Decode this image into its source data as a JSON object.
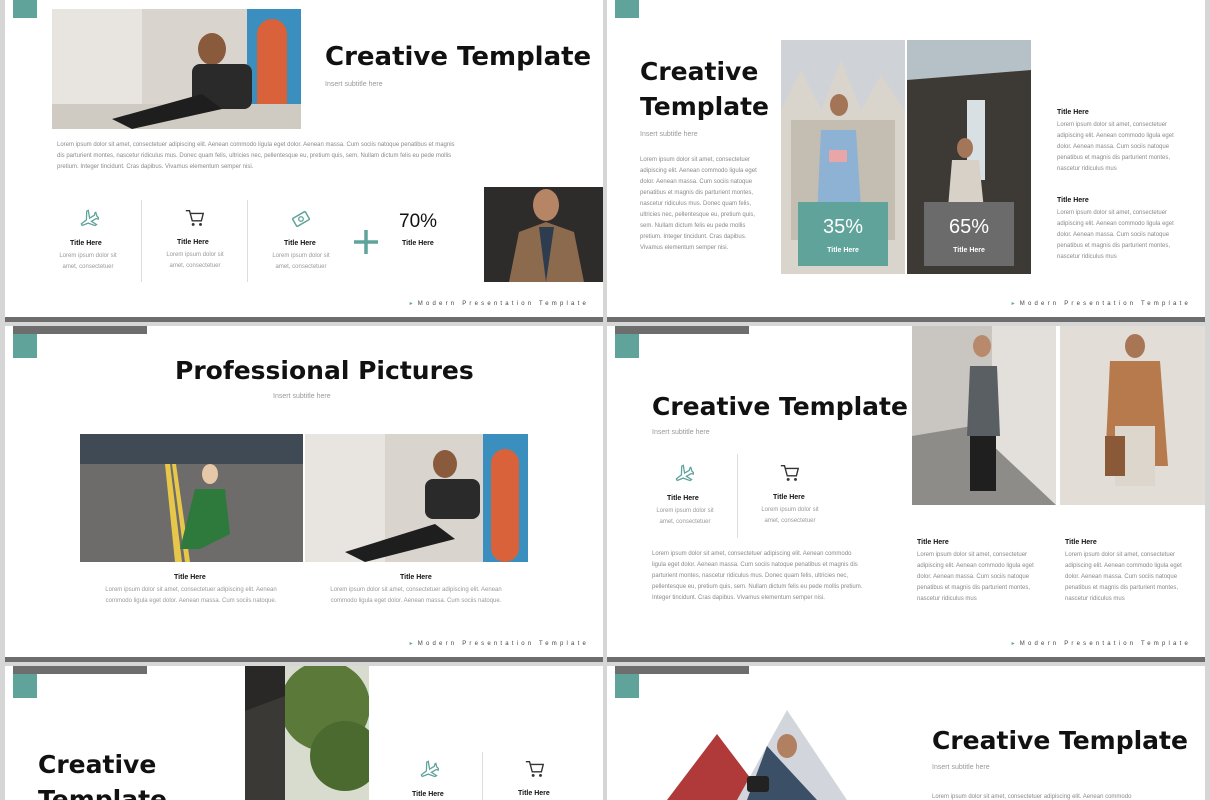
{
  "footer": "Modern Presentation Template",
  "lorem_long": "Lorem ipsum dolor sit amet, consectetuer adipiscing elit. Aenean commodo ligula eget dolor. Aenean massa. Cum sociis natoque penatibus et magnis dis parturient montes, nascetur ridiculus mus. Donec quam felis, ultricies nec, pellentesque eu, pretium quis, sem. Nullam dictum felis eu pede mollis pretium. Integer tincidunt. Cras dapibus. Vivamus elementum semper nisi.",
  "lorem_short": "Lorem ipsum dolor sit amet, consectetuer",
  "lorem_mid": "Lorem ipsum dolor sit amet, consectetuer adipiscing elit. Aenean commodo ligula eget dolor. Aenean massa. Cum sociis natoque penatibus et magnis dis parturient montes, nascetur ridiculus mus",
  "lorem_two": "Lorem ipsum dolor sit amet, consectetuer adipiscing elit. Aenean commodo ligula eget dolor. Aenean massa. Cum sociis natoque.",
  "slide1": {
    "title": "Creative Template",
    "subtitle": "Insert subtitle here",
    "features": [
      {
        "icon": "airplane-icon",
        "label": "Title Here"
      },
      {
        "icon": "cart-icon",
        "label": "Title Here"
      },
      {
        "icon": "money-icon",
        "label": "Title Here"
      }
    ],
    "percent": "70%",
    "percent_label": "Title Here"
  },
  "slide2": {
    "title_line1": "Creative",
    "title_line2": "Template",
    "subtitle": "Insert subtitle here",
    "stats": [
      {
        "value": "35%",
        "label": "Title Here"
      },
      {
        "value": "65%",
        "label": "Title Here"
      }
    ],
    "items": [
      {
        "title": "Title Here"
      },
      {
        "title": "Title Here"
      }
    ]
  },
  "slide3": {
    "title": "Professional Pictures",
    "subtitle": "Insert subtitle here",
    "captions": [
      {
        "title": "Title Here"
      },
      {
        "title": "Title Here"
      }
    ]
  },
  "slide4": {
    "title": "Creative Template",
    "subtitle": "Insert subtitle here",
    "features": [
      {
        "label": "Title Here"
      },
      {
        "label": "Title Here"
      }
    ],
    "items": [
      {
        "title": "Title Here"
      },
      {
        "title": "Title Here"
      }
    ]
  },
  "slide5": {
    "title_line1": "Creative",
    "title_line2": "Template",
    "features": [
      {
        "label": "Title Here"
      },
      {
        "label": "Title Here"
      }
    ]
  },
  "slide6": {
    "title": "Creative Template",
    "subtitle": "Insert subtitle here",
    "lorem": "Lorem ipsum dolor sit amet, consectetuer adipiscing elit. Aenean commodo"
  },
  "colors": {
    "accent": "#5fa39b",
    "dark_gray": "#6d6d6d",
    "stat_teal": "#5fa39b",
    "stat_gray": "#6b6b6b"
  }
}
